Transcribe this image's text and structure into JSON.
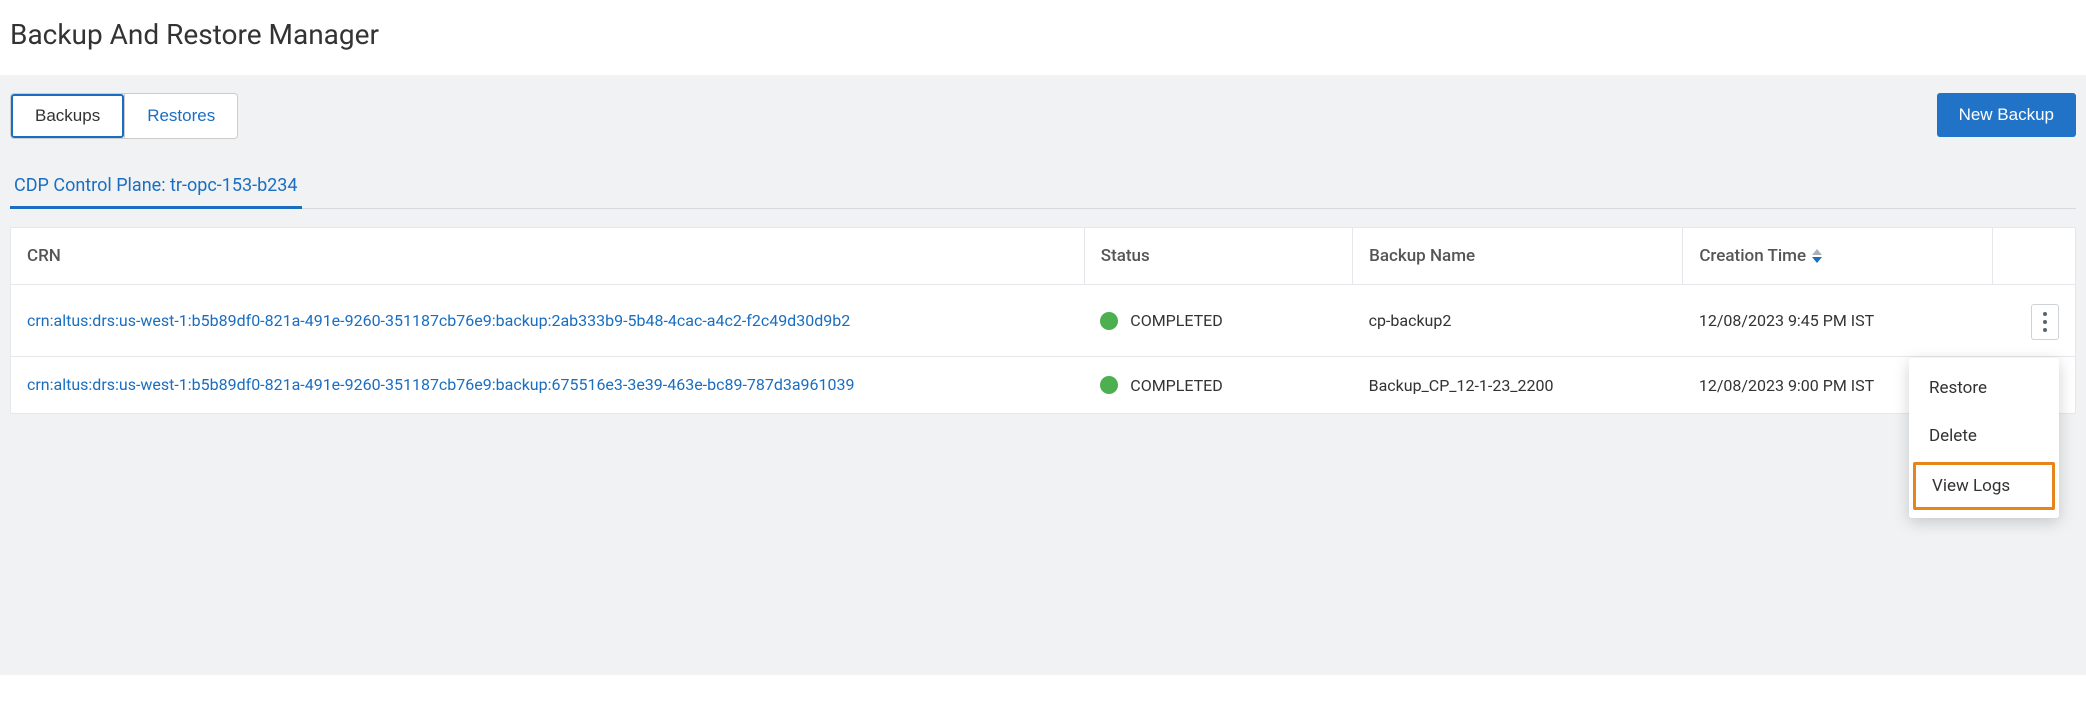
{
  "page_title": "Backup And Restore Manager",
  "tabs": {
    "backups": "Backups",
    "restores": "Restores"
  },
  "new_backup_label": "New Backup",
  "control_plane_label": "CDP Control Plane: tr-opc-153-b234",
  "columns": {
    "crn": "CRN",
    "status": "Status",
    "backup_name": "Backup Name",
    "creation_time": "Creation Time"
  },
  "rows": [
    {
      "crn": "crn:altus:drs:us-west-1:b5b89df0-821a-491e-9260-351187cb76e9:backup:2ab333b9-5b48-4cac-a4c2-f2c49d30d9b2",
      "status": "COMPLETED",
      "backup_name": "cp-backup2",
      "creation_time": "12/08/2023 9:45 PM IST"
    },
    {
      "crn": "crn:altus:drs:us-west-1:b5b89df0-821a-491e-9260-351187cb76e9:backup:675516e3-3e39-463e-bc89-787d3a961039",
      "status": "COMPLETED",
      "backup_name": "Backup_CP_12-1-23_2200",
      "creation_time": "12/08/2023 9:00 PM IST"
    }
  ],
  "menu": {
    "restore": "Restore",
    "delete": "Delete",
    "view_logs": "View Logs"
  }
}
